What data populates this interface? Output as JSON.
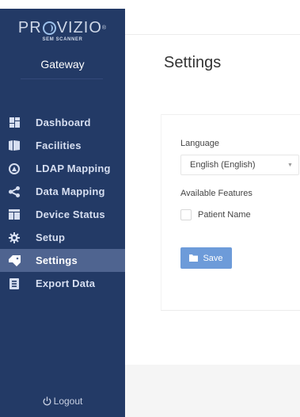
{
  "sidebar": {
    "logo_text_left": "PR",
    "logo_text_right": "VIZIO",
    "logo_trademark": "®",
    "logo_subtitle": "SEM SCANNER",
    "app_name": "Gateway",
    "items": [
      {
        "label": "Dashboard",
        "icon": "dashboard-icon"
      },
      {
        "label": "Facilities",
        "icon": "facilities-icon"
      },
      {
        "label": "LDAP Mapping",
        "icon": "ldap-icon"
      },
      {
        "label": "Data Mapping",
        "icon": "share-icon"
      },
      {
        "label": "Device Status",
        "icon": "device-status-icon"
      },
      {
        "label": "Setup",
        "icon": "gear-icon"
      },
      {
        "label": "Settings",
        "icon": "settings-tag-icon",
        "active": true
      },
      {
        "label": "Export Data",
        "icon": "export-icon"
      }
    ],
    "logout_label": "Logout"
  },
  "main": {
    "title": "Settings",
    "language_label": "Language",
    "language_value": "English  (English)",
    "features_label": "Available Features",
    "feature_patient_name": "Patient Name",
    "feature_patient_name_checked": false,
    "save_label": "Save"
  },
  "colors": {
    "sidebar_bg": "#233a66",
    "sidebar_active": "#4f6490",
    "accent_button": "#6d9bd9"
  }
}
